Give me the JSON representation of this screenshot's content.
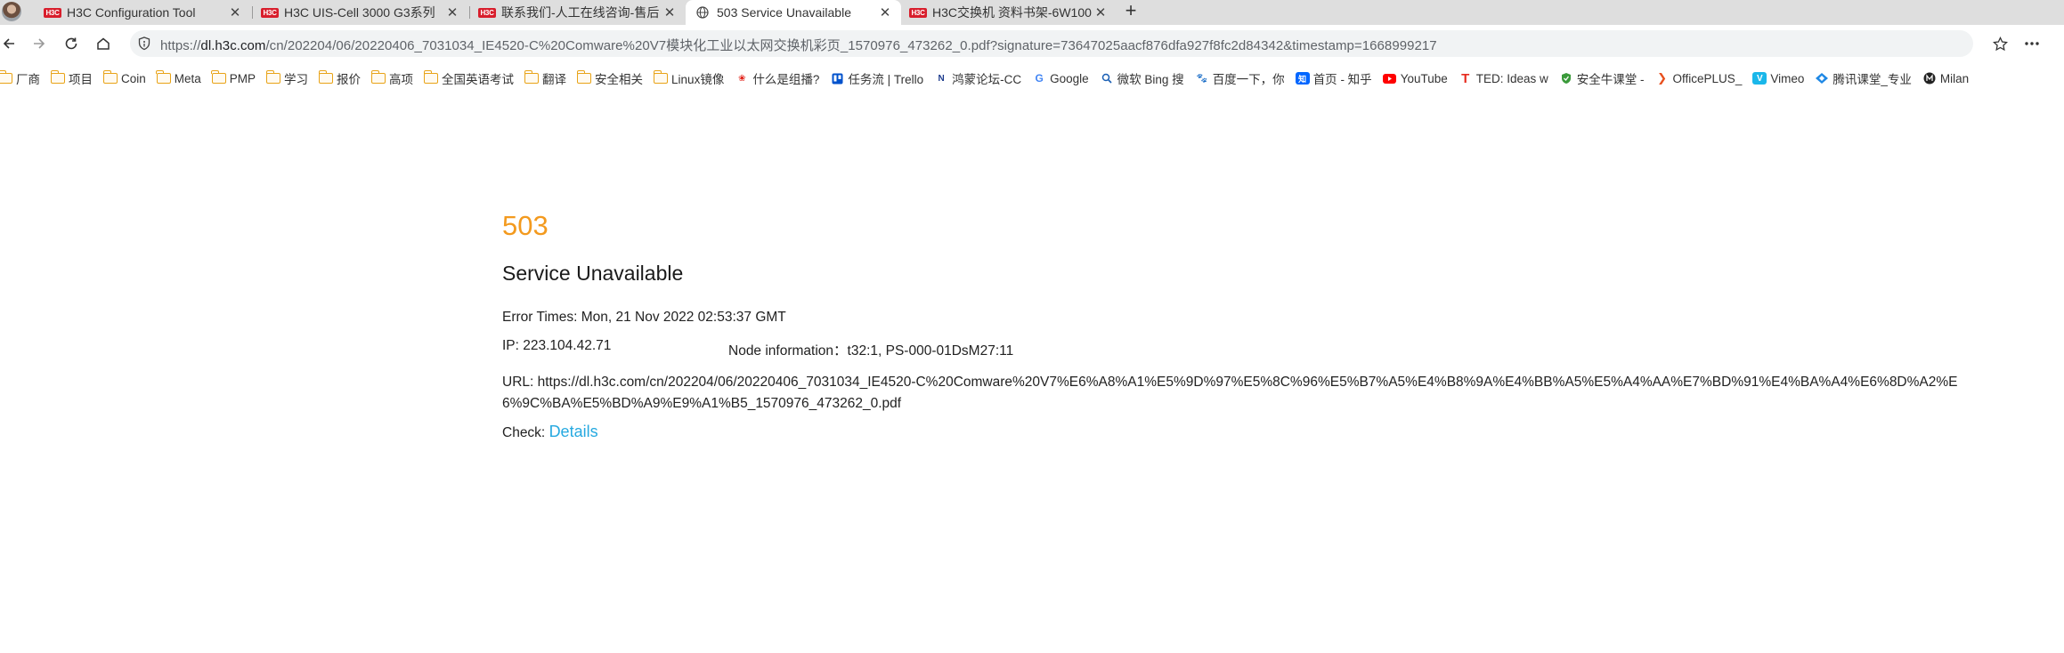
{
  "tabs": [
    {
      "favicon": "H3C",
      "title": "H3C Configuration Tool",
      "active": false
    },
    {
      "favicon": "H3C",
      "title": "H3C UIS-Cell 3000 G3系列",
      "active": false
    },
    {
      "favicon": "H3C",
      "title": "联系我们-人工在线咨询-售后",
      "active": false
    },
    {
      "favicon": "globe-icon",
      "title": "503 Service Unavailable",
      "active": true
    },
    {
      "favicon": "H3C",
      "title": "H3C交换机 资料书架-6W100",
      "active": false
    }
  ],
  "new_tab_glyph": "+",
  "close_glyph": "✕",
  "omnibox": {
    "scheme": "https://",
    "host": "dl.h3c.com",
    "path": "/cn/202204/06/20220406_7031034_IE4520-C%20Comware%20V7模块化工业以太网交换机彩页_1570976_473262_0.pdf?signature=73647025aacf876dfa927f8fc2d84342&timestamp=1668999217"
  },
  "bookmarks": [
    {
      "icon": "folder",
      "label": "厂商"
    },
    {
      "icon": "folder",
      "label": "项目"
    },
    {
      "icon": "folder",
      "label": "Coin"
    },
    {
      "icon": "folder",
      "label": "Meta"
    },
    {
      "icon": "folder",
      "label": "PMP"
    },
    {
      "icon": "folder",
      "label": "学习"
    },
    {
      "icon": "folder",
      "label": "报价"
    },
    {
      "icon": "folder",
      "label": "高项"
    },
    {
      "icon": "folder",
      "label": "全国英语考试"
    },
    {
      "icon": "folder",
      "label": "翻译"
    },
    {
      "icon": "folder",
      "label": "安全相关"
    },
    {
      "icon": "folder",
      "label": "Linux镜像"
    },
    {
      "icon": "huawei-icon",
      "label": "什么是组播?"
    },
    {
      "icon": "trello-icon",
      "label": "任务流 | Trello"
    },
    {
      "icon": "hongmeng-icon",
      "label": "鸿蒙论坛-CC"
    },
    {
      "icon": "google-icon",
      "label": "Google"
    },
    {
      "icon": "bing-icon",
      "label": "微软 Bing 搜"
    },
    {
      "icon": "baidu-icon",
      "label": "百度一下，你"
    },
    {
      "icon": "zhihu-icon",
      "label": "首页 - 知乎"
    },
    {
      "icon": "youtube-icon",
      "label": "YouTube"
    },
    {
      "icon": "ted-icon",
      "label": "TED: Ideas w"
    },
    {
      "icon": "anquanniu-icon",
      "label": "安全牛课堂 -"
    },
    {
      "icon": "officeplus-icon",
      "label": "OfficePLUS_"
    },
    {
      "icon": "vimeo-icon",
      "label": "Vimeo"
    },
    {
      "icon": "tencent-classroom-icon",
      "label": "腾讯课堂_专业"
    },
    {
      "icon": "milan-icon",
      "label": "Milan"
    }
  ],
  "error_page": {
    "code": "503",
    "title": "Service Unavailable",
    "error_times_label": "Error Times: ",
    "error_times_value": "Mon, 21 Nov 2022 02:53:37 GMT",
    "ip_label": "IP: ",
    "ip_value": "223.104.42.71",
    "node_label": "Node information：",
    "node_value": "t32:1, PS-000-01DsM27:11",
    "url_label": "URL: ",
    "url_value": "https://dl.h3c.com/cn/202204/06/20220406_7031034_IE4520-C%20Comware%20V7%E6%A8%A1%E5%9D%97%E5%8C%96%E5%B7%A5%E4%B8%9A%E4%BB%A5%E5%A4%AA%E7%BD%91%E4%BA%A4%E6%8D%A2%E6%9C%BA%E5%BD%A9%E9%A1%B5_1570976_473262_0.pdf",
    "check_label": "Check: ",
    "details_link": "Details"
  },
  "colors": {
    "error_code": "#f39a1e",
    "link": "#26a9e0",
    "h3c_red": "#d81e2c"
  }
}
